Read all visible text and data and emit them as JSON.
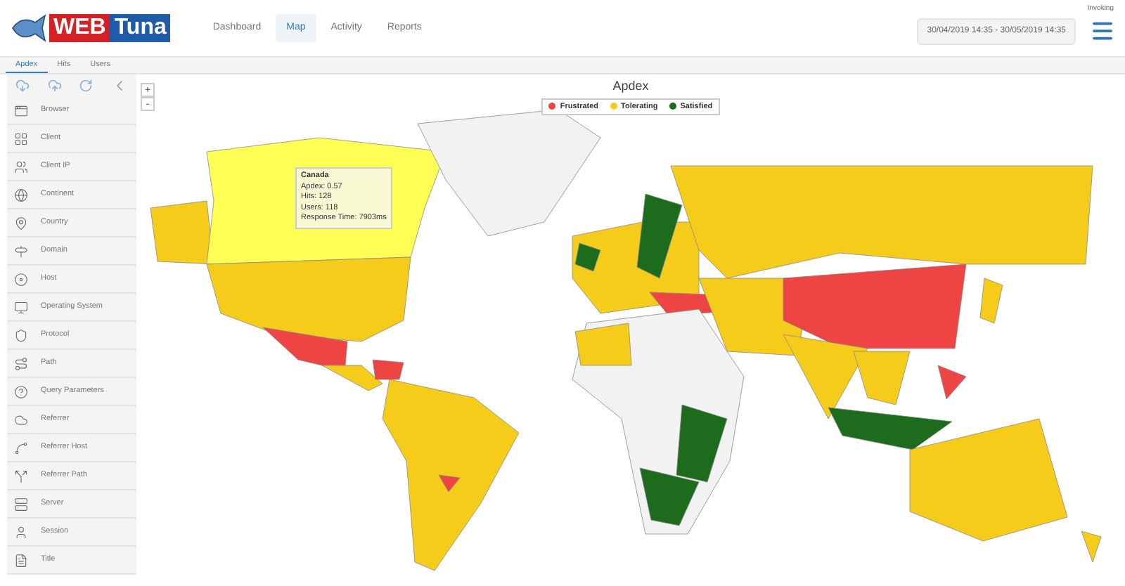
{
  "header": {
    "logo": {
      "first": "WEB",
      "second": "Tuna"
    },
    "nav": [
      {
        "label": "Dashboard",
        "selected": false
      },
      {
        "label": "Map",
        "selected": true
      },
      {
        "label": "Activity",
        "selected": false
      },
      {
        "label": "Reports",
        "selected": false
      }
    ],
    "user": "Invoking",
    "date_range": "30/04/2019 14:35 - 30/05/2019 14:35"
  },
  "tabs": [
    {
      "label": "Apdex",
      "selected": true
    },
    {
      "label": "Hits",
      "selected": false
    },
    {
      "label": "Users",
      "selected": false
    }
  ],
  "sidebar": {
    "items": [
      {
        "label": "Browser"
      },
      {
        "label": "Client"
      },
      {
        "label": "Client IP"
      },
      {
        "label": "Continent"
      },
      {
        "label": "Country"
      },
      {
        "label": "Domain"
      },
      {
        "label": "Host"
      },
      {
        "label": "Operating System"
      },
      {
        "label": "Protocol"
      },
      {
        "label": "Path"
      },
      {
        "label": "Query Parameters"
      },
      {
        "label": "Referrer"
      },
      {
        "label": "Referrer Host"
      },
      {
        "label": "Referrer Path"
      },
      {
        "label": "Server"
      },
      {
        "label": "Session"
      },
      {
        "label": "Title"
      }
    ]
  },
  "map": {
    "title": "Apdex",
    "zoom_buttons": [
      "+",
      "-"
    ],
    "legend": [
      {
        "label": "Frustrated",
        "color": "#ee4444"
      },
      {
        "label": "Tolerating",
        "color": "#f6cc1a"
      },
      {
        "label": "Satisfied",
        "color": "#1d6b1d"
      }
    ],
    "tooltip": {
      "title": "Canada",
      "lines": [
        "Apdex: 0.57",
        "Hits: 128",
        "Users: 118",
        "Response Time: 7903ms"
      ]
    }
  }
}
